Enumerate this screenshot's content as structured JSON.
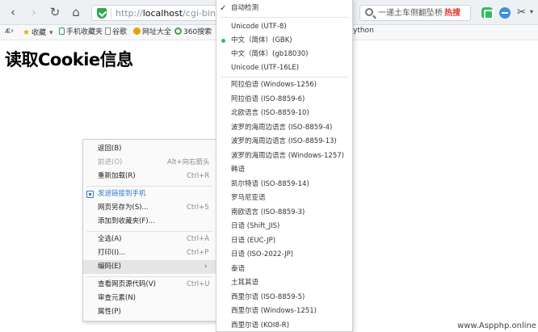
{
  "toolbar": {
    "back_icon": "back-arrow-icon",
    "forward_icon": "forward-arrow-icon",
    "reload_icon": "reload-icon",
    "home_icon": "home-icon",
    "url_scheme": "http://",
    "url_host": "localhost",
    "url_path": "/cgi-bin/test_c",
    "search_text": "一递土车侧翻坠桥",
    "hot_badge": "热搜"
  },
  "bookmarks": [
    {
      "label": "收藏",
      "icon": "star-icon"
    },
    {
      "label": "手机收藏夹",
      "icon": "phone-icon"
    },
    {
      "label": "谷歌",
      "icon": "page-icon"
    },
    {
      "label": "网址大全",
      "icon": "web-directory-icon"
    },
    {
      "label": "360搜索",
      "icon": "360-search-icon"
    }
  ],
  "bookmarks_partial": "ython",
  "page": {
    "title": "读取Cookie信息"
  },
  "context_menu": {
    "items": [
      {
        "label": "返回(B)",
        "shortcut": ""
      },
      {
        "label": "前进(O)",
        "shortcut": "Alt+向右箭头",
        "disabled": true
      },
      {
        "label": "重新加载(R)",
        "shortcut": "Ctrl+R"
      },
      {
        "label": "发送链接到手机",
        "shortcut": "",
        "link": true
      },
      {
        "label": "网页另存为(S)...",
        "shortcut": "Ctrl+S"
      },
      {
        "label": "添加到收藏夹(F)...",
        "shortcut": ""
      },
      {
        "label": "全选(A)",
        "shortcut": "Ctrl+A"
      },
      {
        "label": "打印(I)...",
        "shortcut": "Ctrl+P"
      },
      {
        "label": "编码(E)",
        "shortcut": "",
        "submenu": true
      },
      {
        "label": "查看网页源代码(V)",
        "shortcut": "Ctrl+U"
      },
      {
        "label": "审查元素(N)",
        "shortcut": ""
      },
      {
        "label": "属性(P)",
        "shortcut": ""
      }
    ]
  },
  "encoding_menu": {
    "items": [
      {
        "label": "自动检测",
        "checked": true
      },
      {
        "label": "Unicode (UTF-8)"
      },
      {
        "label": "中文（简体）(GBK)",
        "selected": true
      },
      {
        "label": "中文（简体）(gb18030)"
      },
      {
        "label": "Unicode (UTF-16LE)"
      },
      {
        "label": "阿拉伯语 (Windows-1256)"
      },
      {
        "label": "阿拉伯语 (ISO-8859-6)"
      },
      {
        "label": "北欧语言 (ISO-8859-10)"
      },
      {
        "label": "波罗的海周边语言 (ISO-8859-4)"
      },
      {
        "label": "波罗的海周边语言 (ISO-8859-13)"
      },
      {
        "label": "波罗的海周边语言 (Windows-1257)"
      },
      {
        "label": "韩语"
      },
      {
        "label": "凯尔特语 (ISO-8859-14)"
      },
      {
        "label": "罗马尼亚语"
      },
      {
        "label": "南欧语言 (ISO-8859-3)"
      },
      {
        "label": "日语 (Shift_JIS)"
      },
      {
        "label": "日语 (EUC-JP)"
      },
      {
        "label": "日语 (ISO-2022-JP)"
      },
      {
        "label": "泰语"
      },
      {
        "label": "土耳其语"
      },
      {
        "label": "西里尔语 (ISO-8859-5)"
      },
      {
        "label": "西里尔语 (Windows-1251)"
      },
      {
        "label": "西里尔语 (KOI8-R)"
      }
    ]
  },
  "watermark": "www.Aspphp.online",
  "colors": {
    "accent_blue": "#2a7ad5",
    "selected_dot": "#2fbf5a",
    "hot_red": "#e03a2f"
  }
}
